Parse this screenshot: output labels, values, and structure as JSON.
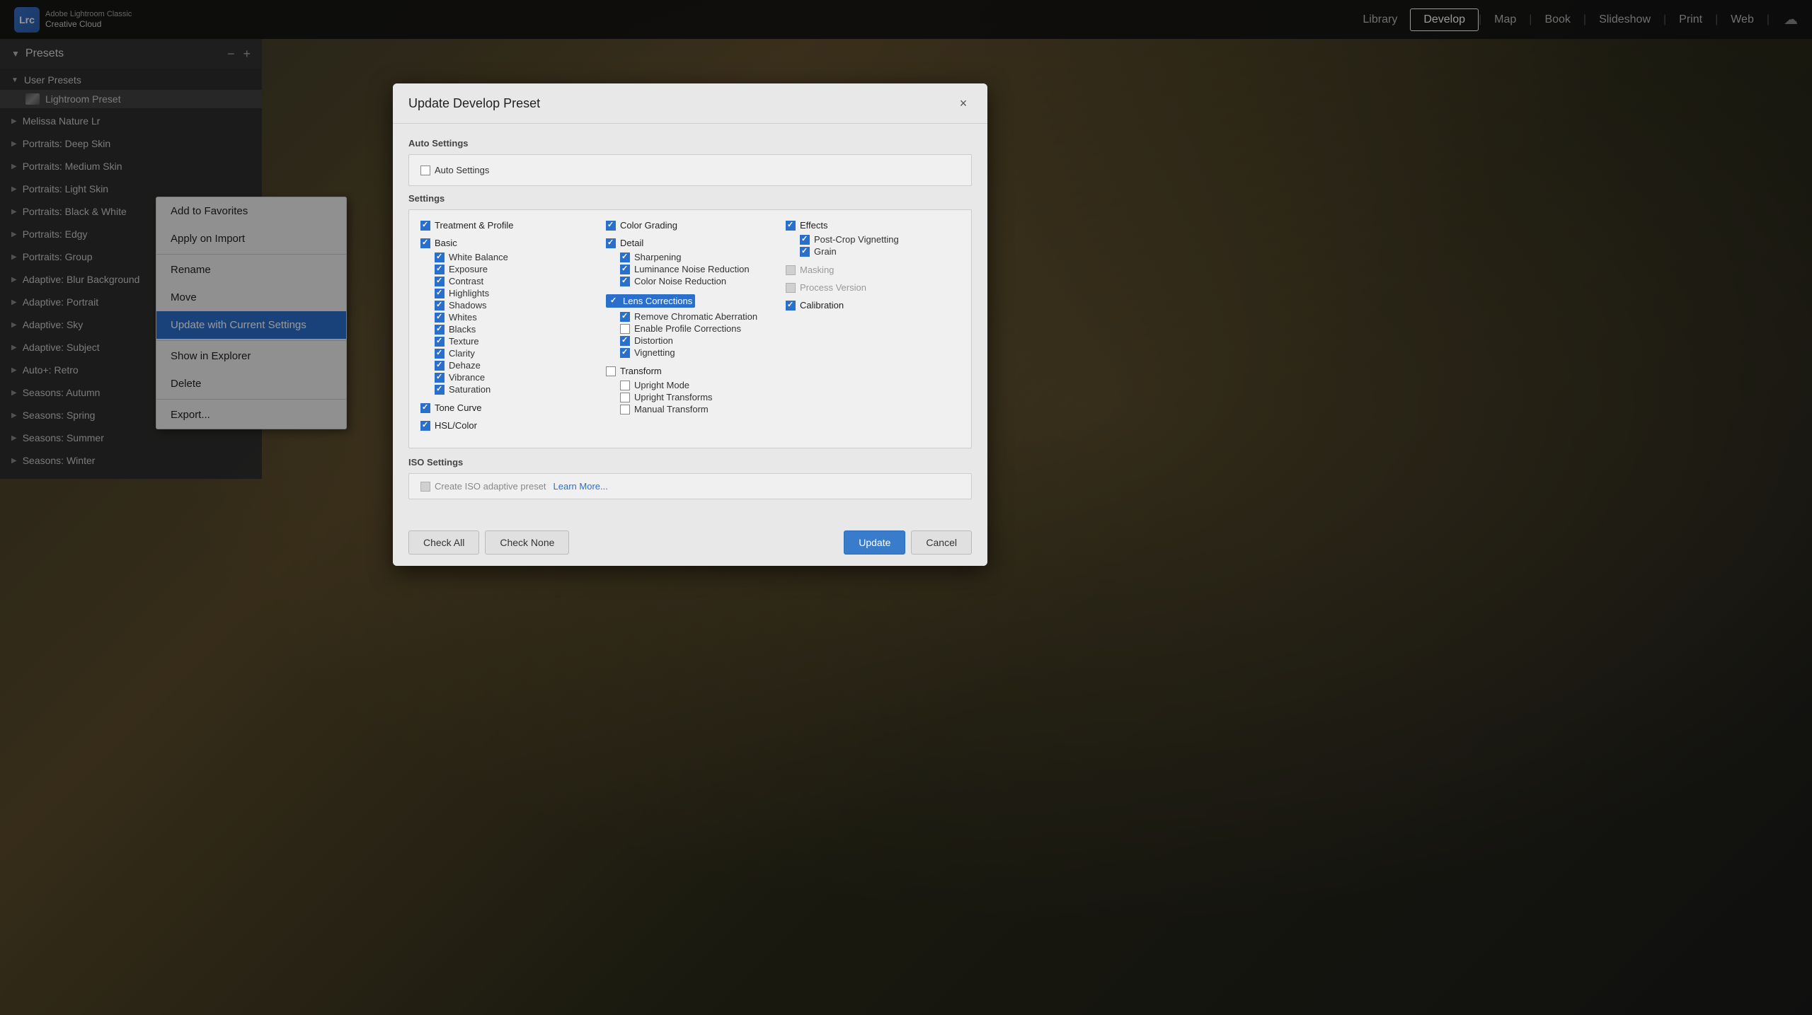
{
  "app": {
    "name": "Adobe Lightroom Classic",
    "subname": "Creative Cloud",
    "logo_text": "Lrc"
  },
  "nav": {
    "items": [
      "Library",
      "Develop",
      "Map",
      "Book",
      "Slideshow",
      "Print",
      "Web"
    ],
    "active": "Develop"
  },
  "sidebar": {
    "title": "Presets",
    "minus_label": "−",
    "plus_label": "+",
    "groups": [
      {
        "name": "User Presets",
        "open": true,
        "items": [
          {
            "name": "Lightroom Preset",
            "selected": true
          }
        ]
      },
      {
        "name": "Melissa Nature Lr",
        "open": false,
        "items": []
      },
      {
        "name": "Portraits: Deep Skin",
        "open": false,
        "items": []
      },
      {
        "name": "Portraits: Medium Skin",
        "open": false,
        "items": []
      },
      {
        "name": "Portraits: Light Skin",
        "open": false,
        "items": []
      },
      {
        "name": "Portraits: Black & White",
        "open": false,
        "items": []
      },
      {
        "name": "Portraits: Edgy",
        "open": false,
        "items": []
      },
      {
        "name": "Portraits: Group",
        "open": false,
        "items": []
      },
      {
        "name": "Adaptive: Blur Background",
        "open": false,
        "items": []
      },
      {
        "name": "Adaptive: Portrait",
        "open": false,
        "items": []
      },
      {
        "name": "Adaptive: Sky",
        "open": false,
        "items": []
      },
      {
        "name": "Adaptive: Subject",
        "open": false,
        "items": []
      },
      {
        "name": "Auto+: Retro",
        "open": false,
        "items": []
      },
      {
        "name": "Seasons: Autumn",
        "open": false,
        "items": []
      },
      {
        "name": "Seasons: Spring",
        "open": false,
        "items": []
      },
      {
        "name": "Seasons: Summer",
        "open": false,
        "items": []
      },
      {
        "name": "Seasons: Winter",
        "open": false,
        "items": []
      }
    ]
  },
  "context_menu": {
    "items": [
      {
        "label": "Add to Favorites",
        "highlighted": false,
        "separator_after": false
      },
      {
        "label": "Apply on Import",
        "highlighted": false,
        "separator_after": false
      },
      {
        "label": "",
        "separator": true
      },
      {
        "label": "Rename",
        "highlighted": false,
        "separator_after": false
      },
      {
        "label": "Move",
        "highlighted": false,
        "separator_after": false
      },
      {
        "label": "Update with Current Settings",
        "highlighted": true,
        "separator_after": false
      },
      {
        "label": "",
        "separator": true
      },
      {
        "label": "Show in Explorer",
        "highlighted": false,
        "separator_after": false
      },
      {
        "label": "Delete",
        "highlighted": false,
        "separator_after": false
      },
      {
        "label": "",
        "separator": true
      },
      {
        "label": "Export...",
        "highlighted": false,
        "separator_after": false
      }
    ]
  },
  "modal": {
    "title": "Update Develop Preset",
    "close_label": "×",
    "auto_settings": {
      "section_label": "Auto Settings",
      "checkbox_label": "Auto Settings",
      "checked": false
    },
    "settings": {
      "section_label": "Settings",
      "columns": [
        {
          "groups": [
            {
              "label": "Treatment & Profile",
              "checked": true,
              "children": []
            },
            {
              "label": "Basic",
              "checked": true,
              "children": [
                {
                  "label": "White Balance",
                  "checked": true
                },
                {
                  "label": "Exposure",
                  "checked": true
                },
                {
                  "label": "Contrast",
                  "checked": true
                },
                {
                  "label": "Highlights",
                  "checked": true
                },
                {
                  "label": "Shadows",
                  "checked": true
                },
                {
                  "label": "Whites",
                  "checked": true
                },
                {
                  "label": "Blacks",
                  "checked": true
                },
                {
                  "label": "Texture",
                  "checked": true
                },
                {
                  "label": "Clarity",
                  "checked": true
                },
                {
                  "label": "Dehaze",
                  "checked": true
                },
                {
                  "label": "Vibrance",
                  "checked": true
                },
                {
                  "label": "Saturation",
                  "checked": true
                }
              ]
            },
            {
              "label": "Tone Curve",
              "checked": true,
              "children": []
            },
            {
              "label": "HSL/Color",
              "checked": true,
              "children": []
            }
          ]
        },
        {
          "groups": [
            {
              "label": "Color Grading",
              "checked": true,
              "children": []
            },
            {
              "label": "Detail",
              "checked": true,
              "children": [
                {
                  "label": "Sharpening",
                  "checked": true
                },
                {
                  "label": "Luminance Noise Reduction",
                  "checked": true
                },
                {
                  "label": "Color Noise Reduction",
                  "checked": true
                }
              ]
            },
            {
              "label": "Lens Corrections",
              "checked": true,
              "children": [
                {
                  "label": "Remove Chromatic Aberration",
                  "checked": true
                },
                {
                  "label": "Enable Profile Corrections",
                  "checked": false
                },
                {
                  "label": "Distortion",
                  "checked": true
                },
                {
                  "label": "Vignetting",
                  "checked": true
                }
              ]
            },
            {
              "label": "Transform",
              "checked": false,
              "children": [
                {
                  "label": "Upright Mode",
                  "checked": false
                },
                {
                  "label": "Upright Transforms",
                  "checked": false
                },
                {
                  "label": "Manual Transform",
                  "checked": false
                }
              ]
            }
          ]
        },
        {
          "groups": [
            {
              "label": "Effects",
              "checked": true,
              "children": [
                {
                  "label": "Post-Crop Vignetting",
                  "checked": true
                },
                {
                  "label": "Grain",
                  "checked": true
                }
              ]
            },
            {
              "label": "Masking",
              "checked": false,
              "disabled": true,
              "children": []
            },
            {
              "label": "Process Version",
              "checked": false,
              "disabled": true,
              "children": []
            },
            {
              "label": "Calibration",
              "checked": true,
              "children": []
            }
          ]
        }
      ]
    },
    "iso_settings": {
      "section_label": "ISO Settings",
      "checkbox_label": "Create ISO adaptive preset",
      "checked": false,
      "disabled": true,
      "learn_more_label": "Learn More..."
    },
    "footer": {
      "check_all_label": "Check All",
      "check_none_label": "Check None",
      "update_label": "Update",
      "cancel_label": "Cancel"
    }
  }
}
